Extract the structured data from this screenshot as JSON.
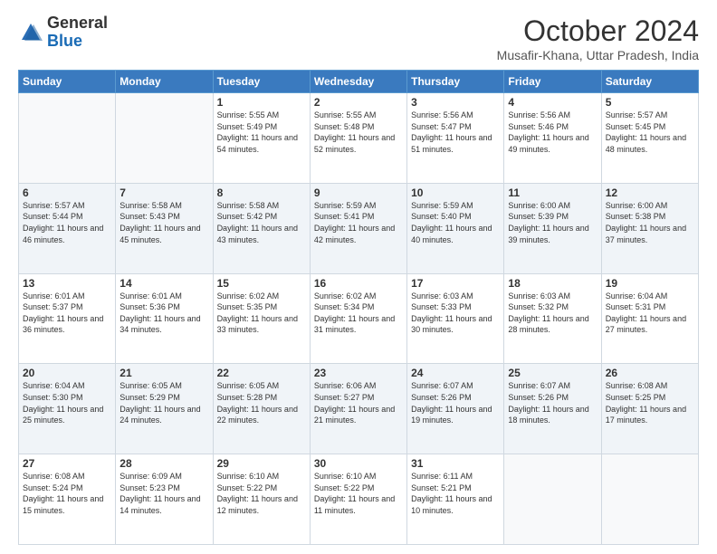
{
  "logo": {
    "line1": "General",
    "line2": "Blue"
  },
  "header": {
    "month": "October 2024",
    "location": "Musafir-Khana, Uttar Pradesh, India"
  },
  "weekdays": [
    "Sunday",
    "Monday",
    "Tuesday",
    "Wednesday",
    "Thursday",
    "Friday",
    "Saturday"
  ],
  "weeks": [
    [
      {
        "day": "",
        "sunrise": "",
        "sunset": "",
        "daylight": ""
      },
      {
        "day": "",
        "sunrise": "",
        "sunset": "",
        "daylight": ""
      },
      {
        "day": "1",
        "sunrise": "Sunrise: 5:55 AM",
        "sunset": "Sunset: 5:49 PM",
        "daylight": "Daylight: 11 hours and 54 minutes."
      },
      {
        "day": "2",
        "sunrise": "Sunrise: 5:55 AM",
        "sunset": "Sunset: 5:48 PM",
        "daylight": "Daylight: 11 hours and 52 minutes."
      },
      {
        "day": "3",
        "sunrise": "Sunrise: 5:56 AM",
        "sunset": "Sunset: 5:47 PM",
        "daylight": "Daylight: 11 hours and 51 minutes."
      },
      {
        "day": "4",
        "sunrise": "Sunrise: 5:56 AM",
        "sunset": "Sunset: 5:46 PM",
        "daylight": "Daylight: 11 hours and 49 minutes."
      },
      {
        "day": "5",
        "sunrise": "Sunrise: 5:57 AM",
        "sunset": "Sunset: 5:45 PM",
        "daylight": "Daylight: 11 hours and 48 minutes."
      }
    ],
    [
      {
        "day": "6",
        "sunrise": "Sunrise: 5:57 AM",
        "sunset": "Sunset: 5:44 PM",
        "daylight": "Daylight: 11 hours and 46 minutes."
      },
      {
        "day": "7",
        "sunrise": "Sunrise: 5:58 AM",
        "sunset": "Sunset: 5:43 PM",
        "daylight": "Daylight: 11 hours and 45 minutes."
      },
      {
        "day": "8",
        "sunrise": "Sunrise: 5:58 AM",
        "sunset": "Sunset: 5:42 PM",
        "daylight": "Daylight: 11 hours and 43 minutes."
      },
      {
        "day": "9",
        "sunrise": "Sunrise: 5:59 AM",
        "sunset": "Sunset: 5:41 PM",
        "daylight": "Daylight: 11 hours and 42 minutes."
      },
      {
        "day": "10",
        "sunrise": "Sunrise: 5:59 AM",
        "sunset": "Sunset: 5:40 PM",
        "daylight": "Daylight: 11 hours and 40 minutes."
      },
      {
        "day": "11",
        "sunrise": "Sunrise: 6:00 AM",
        "sunset": "Sunset: 5:39 PM",
        "daylight": "Daylight: 11 hours and 39 minutes."
      },
      {
        "day": "12",
        "sunrise": "Sunrise: 6:00 AM",
        "sunset": "Sunset: 5:38 PM",
        "daylight": "Daylight: 11 hours and 37 minutes."
      }
    ],
    [
      {
        "day": "13",
        "sunrise": "Sunrise: 6:01 AM",
        "sunset": "Sunset: 5:37 PM",
        "daylight": "Daylight: 11 hours and 36 minutes."
      },
      {
        "day": "14",
        "sunrise": "Sunrise: 6:01 AM",
        "sunset": "Sunset: 5:36 PM",
        "daylight": "Daylight: 11 hours and 34 minutes."
      },
      {
        "day": "15",
        "sunrise": "Sunrise: 6:02 AM",
        "sunset": "Sunset: 5:35 PM",
        "daylight": "Daylight: 11 hours and 33 minutes."
      },
      {
        "day": "16",
        "sunrise": "Sunrise: 6:02 AM",
        "sunset": "Sunset: 5:34 PM",
        "daylight": "Daylight: 11 hours and 31 minutes."
      },
      {
        "day": "17",
        "sunrise": "Sunrise: 6:03 AM",
        "sunset": "Sunset: 5:33 PM",
        "daylight": "Daylight: 11 hours and 30 minutes."
      },
      {
        "day": "18",
        "sunrise": "Sunrise: 6:03 AM",
        "sunset": "Sunset: 5:32 PM",
        "daylight": "Daylight: 11 hours and 28 minutes."
      },
      {
        "day": "19",
        "sunrise": "Sunrise: 6:04 AM",
        "sunset": "Sunset: 5:31 PM",
        "daylight": "Daylight: 11 hours and 27 minutes."
      }
    ],
    [
      {
        "day": "20",
        "sunrise": "Sunrise: 6:04 AM",
        "sunset": "Sunset: 5:30 PM",
        "daylight": "Daylight: 11 hours and 25 minutes."
      },
      {
        "day": "21",
        "sunrise": "Sunrise: 6:05 AM",
        "sunset": "Sunset: 5:29 PM",
        "daylight": "Daylight: 11 hours and 24 minutes."
      },
      {
        "day": "22",
        "sunrise": "Sunrise: 6:05 AM",
        "sunset": "Sunset: 5:28 PM",
        "daylight": "Daylight: 11 hours and 22 minutes."
      },
      {
        "day": "23",
        "sunrise": "Sunrise: 6:06 AM",
        "sunset": "Sunset: 5:27 PM",
        "daylight": "Daylight: 11 hours and 21 minutes."
      },
      {
        "day": "24",
        "sunrise": "Sunrise: 6:07 AM",
        "sunset": "Sunset: 5:26 PM",
        "daylight": "Daylight: 11 hours and 19 minutes."
      },
      {
        "day": "25",
        "sunrise": "Sunrise: 6:07 AM",
        "sunset": "Sunset: 5:26 PM",
        "daylight": "Daylight: 11 hours and 18 minutes."
      },
      {
        "day": "26",
        "sunrise": "Sunrise: 6:08 AM",
        "sunset": "Sunset: 5:25 PM",
        "daylight": "Daylight: 11 hours and 17 minutes."
      }
    ],
    [
      {
        "day": "27",
        "sunrise": "Sunrise: 6:08 AM",
        "sunset": "Sunset: 5:24 PM",
        "daylight": "Daylight: 11 hours and 15 minutes."
      },
      {
        "day": "28",
        "sunrise": "Sunrise: 6:09 AM",
        "sunset": "Sunset: 5:23 PM",
        "daylight": "Daylight: 11 hours and 14 minutes."
      },
      {
        "day": "29",
        "sunrise": "Sunrise: 6:10 AM",
        "sunset": "Sunset: 5:22 PM",
        "daylight": "Daylight: 11 hours and 12 minutes."
      },
      {
        "day": "30",
        "sunrise": "Sunrise: 6:10 AM",
        "sunset": "Sunset: 5:22 PM",
        "daylight": "Daylight: 11 hours and 11 minutes."
      },
      {
        "day": "31",
        "sunrise": "Sunrise: 6:11 AM",
        "sunset": "Sunset: 5:21 PM",
        "daylight": "Daylight: 11 hours and 10 minutes."
      },
      {
        "day": "",
        "sunrise": "",
        "sunset": "",
        "daylight": ""
      },
      {
        "day": "",
        "sunrise": "",
        "sunset": "",
        "daylight": ""
      }
    ]
  ]
}
